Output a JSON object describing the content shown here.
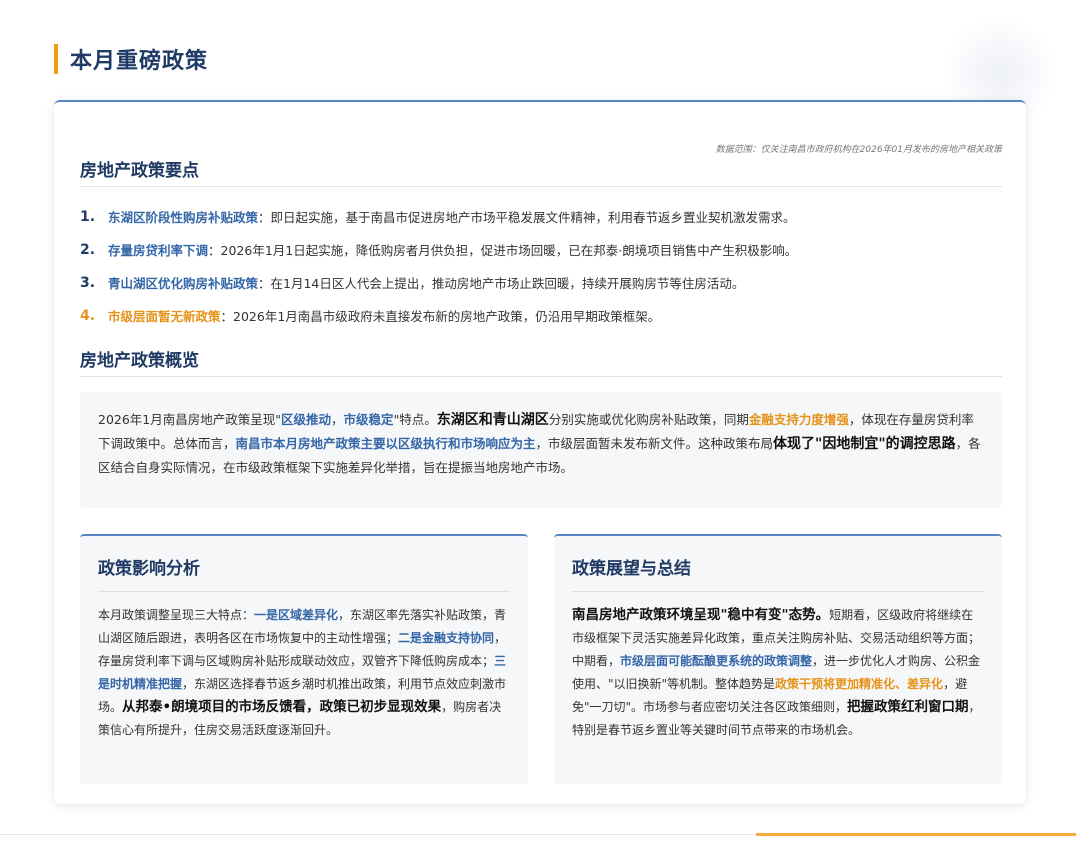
{
  "page_title": "本月重磅政策",
  "data_range": "数据范围：仅关注南昌市政府机构在2026年01月发布的房地产相关政策",
  "key_points": {
    "heading": "房地产政策要点",
    "items": [
      {
        "num": "1.",
        "title": "东湖区阶段性购房补贴政策",
        "text": "：即日起实施，基于南昌市促进房地产市场平稳发展文件精神，利用春节返乡置业契机激发需求。"
      },
      {
        "num": "2.",
        "title": "存量房贷利率下调",
        "text": "：2026年1月1日起实施，降低购房者月供负担，促进市场回暖，已在邦泰·朗境项目销售中产生积极影响。"
      },
      {
        "num": "3.",
        "title": "青山湖区优化购房补贴政策",
        "text": "：在1月14日区人代会上提出，推动房地产市场止跌回暖，持续开展购房节等住房活动。"
      },
      {
        "num": "4.",
        "title": "市级层面暂无新政策",
        "text": "：2026年1月南昌市级政府未直接发布新的房地产政策，仍沿用早期政策框架。"
      }
    ]
  },
  "overview": {
    "heading": "房地产政策概览",
    "t1": "2026年1月南昌房地产政策呈现\"",
    "b1": "区级推动",
    "t2": "，",
    "b2": "市级稳定",
    "t3": "\"特点。",
    "s1": "东湖区和青山湖区",
    "t4": "分别实施或优化购房补贴政策，同期",
    "o1": "金融支持力度增强",
    "t5": "，体现在存量房贷利率下调政策中。总体而言，",
    "b3": "南昌市本月房地产政策主要以区级执行和市场响应为主",
    "t6": "，市级层面暂未发布新文件。这种政策布局",
    "s2": "体现了\"因地制宜\"的调控思路",
    "t7": "，各区结合自身实际情况，在市级政策框架下实施差异化举措，旨在提振当地房地产市场。"
  },
  "impact": {
    "heading": "政策影响分析",
    "t1": "本月政策调整呈现三大特点：",
    "b1": "一是区域差异化",
    "t2": "，东湖区率先落实补贴政策，青山湖区随后跟进，表明各区在市场恢复中的主动性增强；",
    "b2": "二是金融支持协同",
    "t3": "，存量房贷利率下调与区域购房补贴形成联动效应，双管齐下降低购房成本；",
    "b3": "三是时机精准把握",
    "t4": "，东湖区选择春节返乡潮时机推出政策，利用节点效应刺激市场。",
    "s1": "从邦泰•朗境项目的市场反馈看，政策已初步显现效果",
    "t5": "，购房者决策信心有所提升，住房交易活跃度逐渐回升。"
  },
  "outlook": {
    "heading": "政策展望与总结",
    "s1": "南昌房地产政策环境呈现\"稳中有变\"态势。",
    "t1": "短期看，区级政府将继续在市级框架下灵活实施差异化政策，重点关注购房补贴、交易活动组织等方面；中期看，",
    "b1": "市级层面可能酝酿更系统的政策调整",
    "t2": "，进一步优化人才购房、公积金使用、\"以旧换新\"等机制。整体趋势是",
    "o1": "政策干预将更加精准化、差异化",
    "t3": "，避免\"一刀切\"。市场参与者应密切关注各区政策细则，",
    "s2": "把握政策红利窗口期",
    "t4": "，特别是春节返乡置业等关键时间节点带来的市场机会。"
  },
  "colors": {
    "accent_orange": "#f39c12",
    "title_navy": "#1f3a64",
    "key_blue": "#3567a8",
    "highlight_orange": "#e6931a"
  }
}
